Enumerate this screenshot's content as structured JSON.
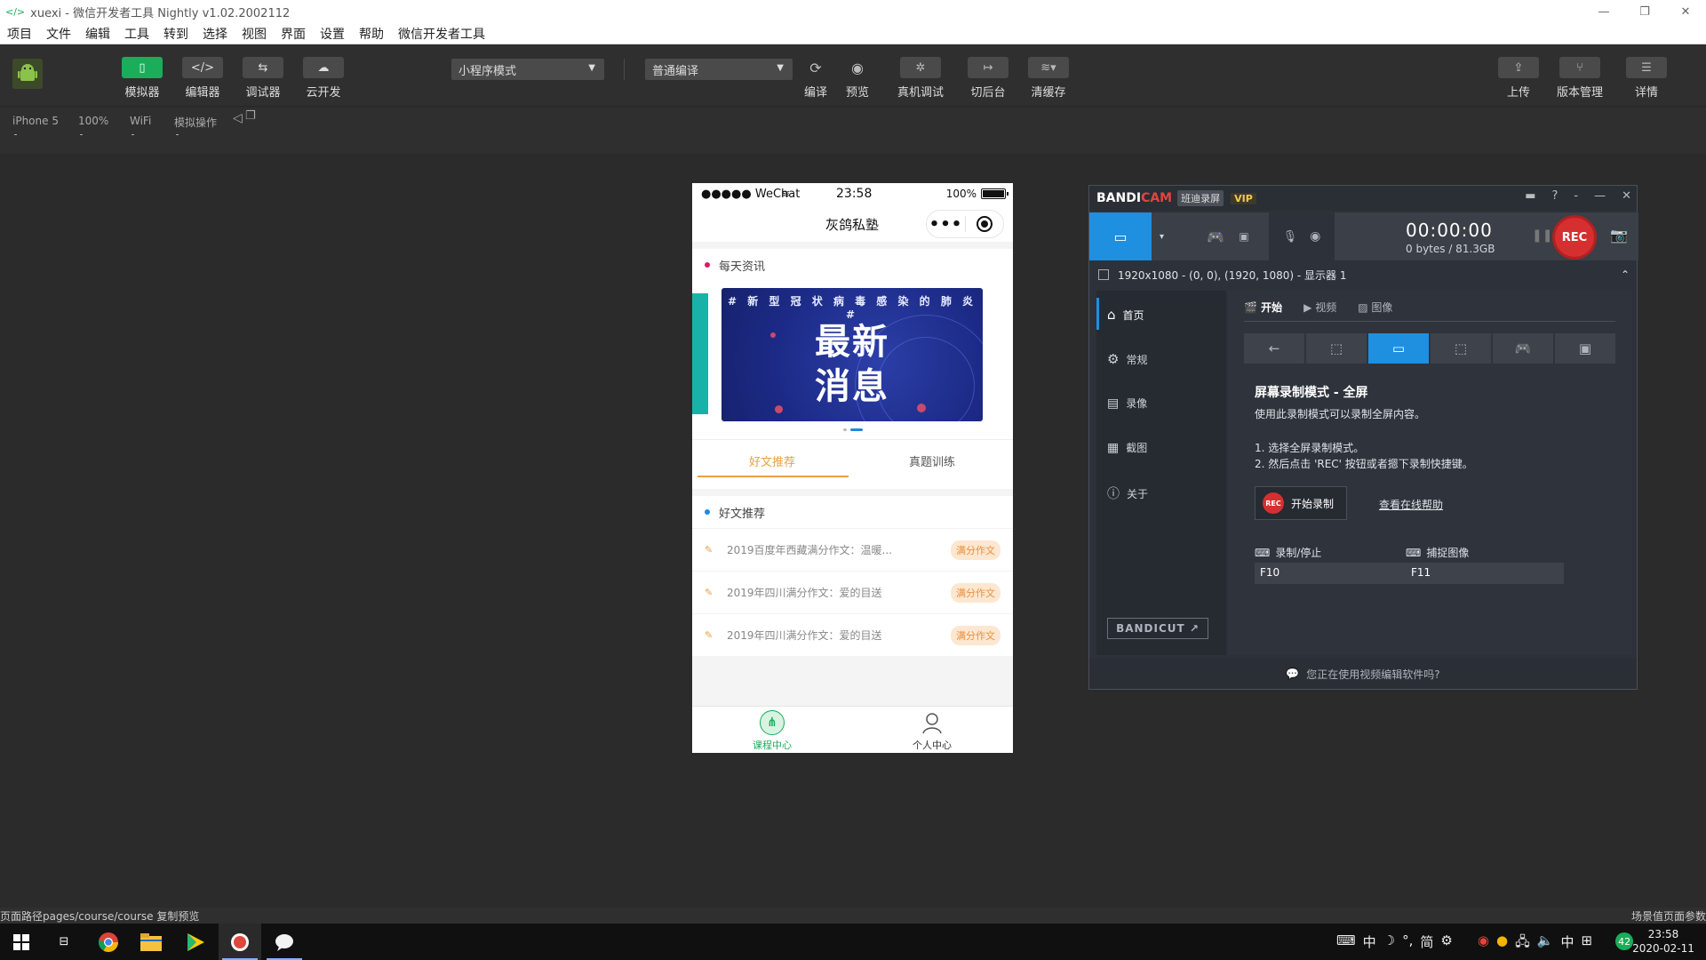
{
  "window": {
    "title": "xuexi - 微信开发者工具 Nightly v1.02.2002112"
  },
  "menu": [
    "项目",
    "文件",
    "编辑",
    "工具",
    "转到",
    "选择",
    "视图",
    "界面",
    "设置",
    "帮助",
    "微信开发者工具"
  ],
  "toolbar": {
    "simulator": "模拟器",
    "editor": "编辑器",
    "debugger": "调试器",
    "cloud": "云开发",
    "mode_select": "小程序模式",
    "compile_select": "普通编译",
    "compile": "编译",
    "preview": "预览",
    "remote_debug": "真机调试",
    "background": "切后台",
    "clear_cache": "清缓存",
    "upload": "上传",
    "version": "版本管理",
    "details": "详情"
  },
  "subbar": {
    "device": "iPhone 5",
    "zoom": "100%",
    "network": "WiFi",
    "ops": "模拟操作"
  },
  "phone": {
    "carrier": "●●●●● WeChat",
    "time": "23:58",
    "battery": "100%",
    "nav_title": "灰鸽私塾",
    "capsule_dots": "•••",
    "section_daily": "每天资讯",
    "banner": {
      "top": "# 新 型 冠 状 病 毒 感 染 的 肺 炎 #",
      "line1": "最新",
      "line2": "消息"
    },
    "tabs": [
      "好文推荐",
      "真题训练"
    ],
    "section_articles": "好文推荐",
    "articles": [
      {
        "title": "2019百度年西藏满分作文：温暖...",
        "badge": "满分作文"
      },
      {
        "title": "2019年四川满分作文：爱的目送",
        "badge": "满分作文"
      },
      {
        "title": "2019年四川满分作文：爱的目送",
        "badge": "满分作文"
      }
    ],
    "tabbar": [
      "课程中心",
      "个人中心"
    ]
  },
  "bandicam": {
    "logo_a": "BANDI",
    "logo_b": "CAM",
    "tag": "班迪录屏",
    "vip": "VIP",
    "timer": "00:00:00",
    "size": "0 bytes / 81.3GB",
    "rec": "REC",
    "info": "1920x1080 - (0, 0), (1920, 1080) - 显示器 1",
    "nav": [
      "首页",
      "常规",
      "录像",
      "截图",
      "关于"
    ],
    "bandicut": "BANDICUT ↗",
    "subtabs": [
      "开始",
      "视频",
      "图像"
    ],
    "heading": "屏幕录制模式 - 全屏",
    "desc": "使用此录制模式可以录制全屏内容。",
    "step1": "1. 选择全屏录制模式。",
    "step2": "2. 然后点击 'REC' 按钮或者摁下录制快捷键。",
    "start_btn": "开始录制",
    "start_badge": "REC",
    "help_link": "查看在线帮助",
    "hk_record_label": "录制/停止",
    "hk_record": "F10",
    "hk_capture_label": "捕捉图像",
    "hk_capture": "F11",
    "footer": "您正在使用视频编辑软件吗?"
  },
  "statusbar": {
    "left": "页面路径pages/course/course 复制预览",
    "right": "场景值页面参数"
  },
  "clock": {
    "time": "23:58",
    "date": "2020-02-11"
  },
  "tray": {
    "badge": "42"
  }
}
